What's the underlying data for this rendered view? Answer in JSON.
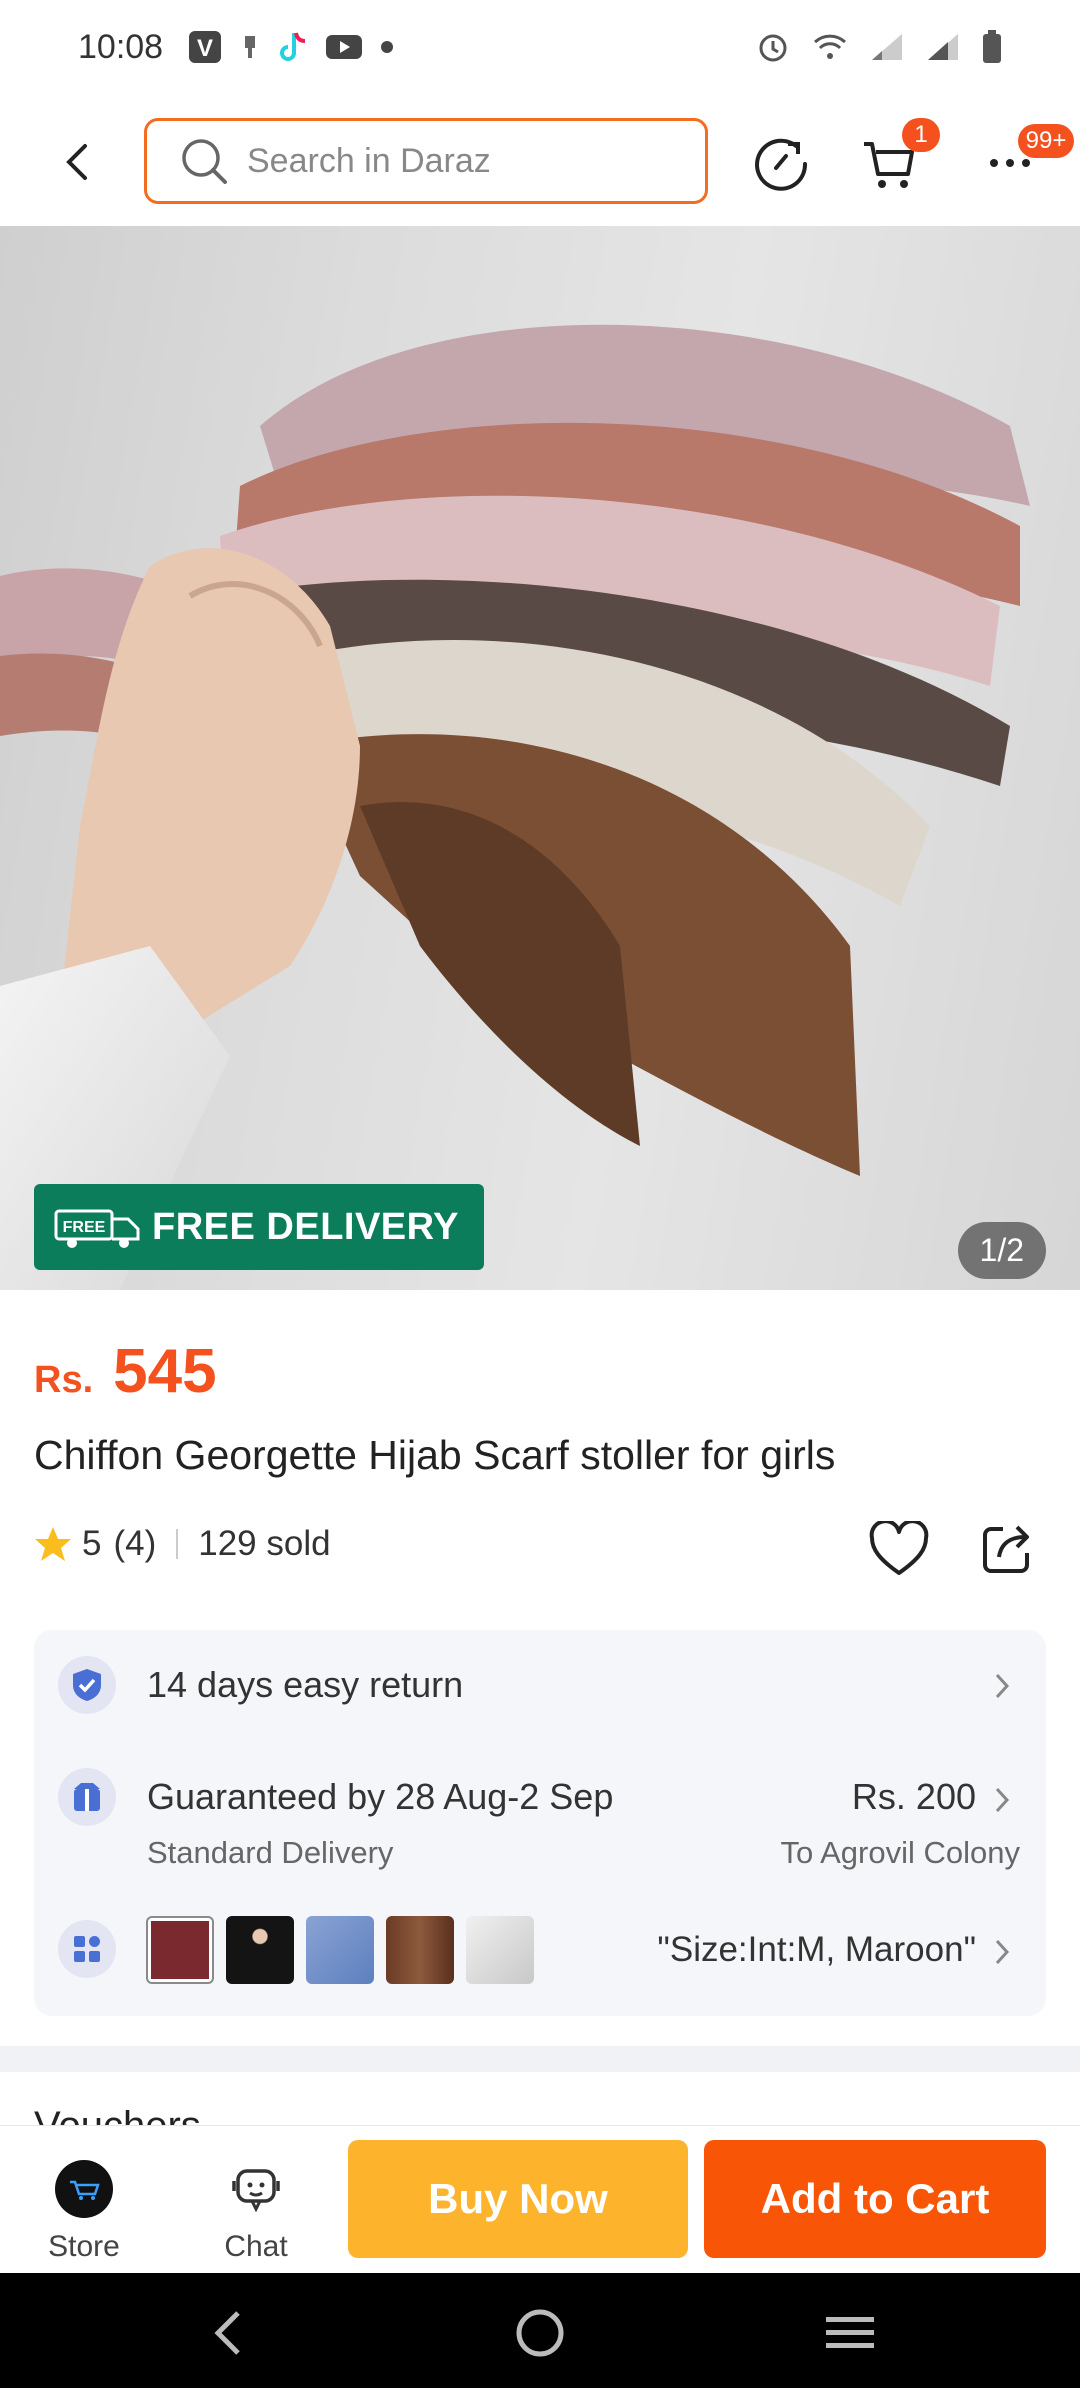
{
  "status_bar": {
    "time": "10:08",
    "left_icons": [
      "v-app-icon",
      "sd-icon",
      "tiktok-icon",
      "youtube-icon",
      "dot-icon"
    ],
    "right_icons": [
      "alarm-icon",
      "wifi-icon",
      "signal-1-icon",
      "signal-2-icon",
      "battery-icon"
    ]
  },
  "header": {
    "search_placeholder": "Search in Daraz",
    "cart_badge": "1",
    "more_badge": "99+",
    "accent_color": "#f36d21"
  },
  "product_image": {
    "badge_text": "FREE DELIVERY",
    "badge_icon_text": "FREE",
    "counter": "1/2"
  },
  "product": {
    "currency": "Rs.",
    "price": "545",
    "title": "Chiffon Georgette Hijab Scarf stoller for girls",
    "rating": "5",
    "rating_count": "(4)",
    "sold": "129 sold"
  },
  "services": {
    "return_text": "14 days easy return",
    "delivery_guarantee": "Guaranteed by 28 Aug-2 Sep",
    "delivery_type": "Standard Delivery",
    "delivery_fee": "Rs. 200",
    "delivery_to": "To Agrovil Colony",
    "selected_variant": "\"Size:Int:M, Maroon\"",
    "variant_colors": [
      "#7a2a2e",
      "#141414",
      "#6f8fc4",
      "#6b3b26",
      "#c8c8c8"
    ]
  },
  "next_section": {
    "heading": "Vouchers"
  },
  "action_bar": {
    "store_label": "Store",
    "chat_label": "Chat",
    "buy_now": "Buy Now",
    "add_to_cart": "Add to Cart",
    "buy_now_color": "#fdb32b",
    "add_to_cart_color": "#f85606"
  },
  "nav_bar": {
    "buttons": [
      "back-icon",
      "home-icon",
      "recents-icon"
    ]
  }
}
